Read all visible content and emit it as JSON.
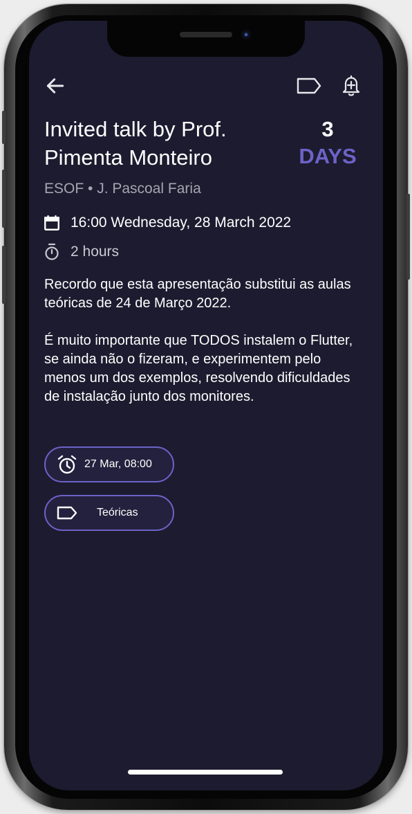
{
  "header": {
    "back_icon": "arrow-left-icon",
    "label_icon": "label-tag-icon",
    "reminder_icon": "bell-plus-icon"
  },
  "event": {
    "title": "Invited talk by Prof. Pimenta Monteiro",
    "countdown_value": "3",
    "countdown_unit": "DAYS",
    "subtitle": "ESOF • J. Pascoal Faria",
    "datetime": "16:00 Wednesday, 28 March 2022",
    "duration": "2 hours",
    "description": [
      "Recordo que esta apresentação substitui as aulas teóricas de 24 de Março 2022.",
      "É muito importante que TODOS instalem o Flutter, se ainda não o fizeram, e experimentem pelo menos um dos exemplos, resolvendo dificuldades de instalação junto dos monitores."
    ]
  },
  "chips": {
    "reminder_label": "27 Mar, 08:00",
    "tag_label": "Teóricas"
  },
  "colors": {
    "background": "#1d1b2f",
    "accent": "#6c63c8",
    "chip_background": "#24213e",
    "text_primary": "#ffffff",
    "text_secondary": "#a6a5b1"
  }
}
